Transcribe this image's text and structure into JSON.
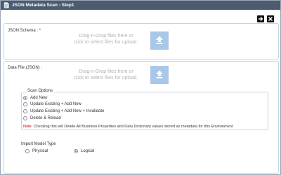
{
  "window": {
    "title": "JSON Metadata Scan - Step1"
  },
  "actions": {
    "next_icon": "arrow-right-icon",
    "close_icon": "close-icon"
  },
  "schema": {
    "label": "JSON Schema :",
    "required_mark": "*",
    "drop_line1": "Drag-n-Drop files here or",
    "drop_line2": "click to select files for upload."
  },
  "datafile": {
    "label": "Data File (JSON) :",
    "drop_line1": "Drag-n-Drop files here or",
    "drop_line2": "click to select files for upload."
  },
  "scan_options": {
    "legend": "Scan Options",
    "options": [
      {
        "label": "Add New",
        "checked": true
      },
      {
        "label": "Update Existing + Add New",
        "checked": false
      },
      {
        "label": "Update Existing + Add New + Invalidate",
        "checked": false
      },
      {
        "label": "Delete & Reload",
        "checked": false
      }
    ],
    "note_label": "Note:",
    "note_text": "Checking this will Delete All Business Properties and Data Dictionary values stored as metadata for this Environment"
  },
  "import_model_type": {
    "label": "Import Model Type",
    "options": [
      {
        "label": "Physical",
        "checked": false
      },
      {
        "label": "Logical",
        "checked": true
      }
    ]
  },
  "colors": {
    "titlebar": "#4c5b70",
    "upload_box": "#a9c8e8",
    "accent": "#2d72b8",
    "note": "#c00000"
  }
}
